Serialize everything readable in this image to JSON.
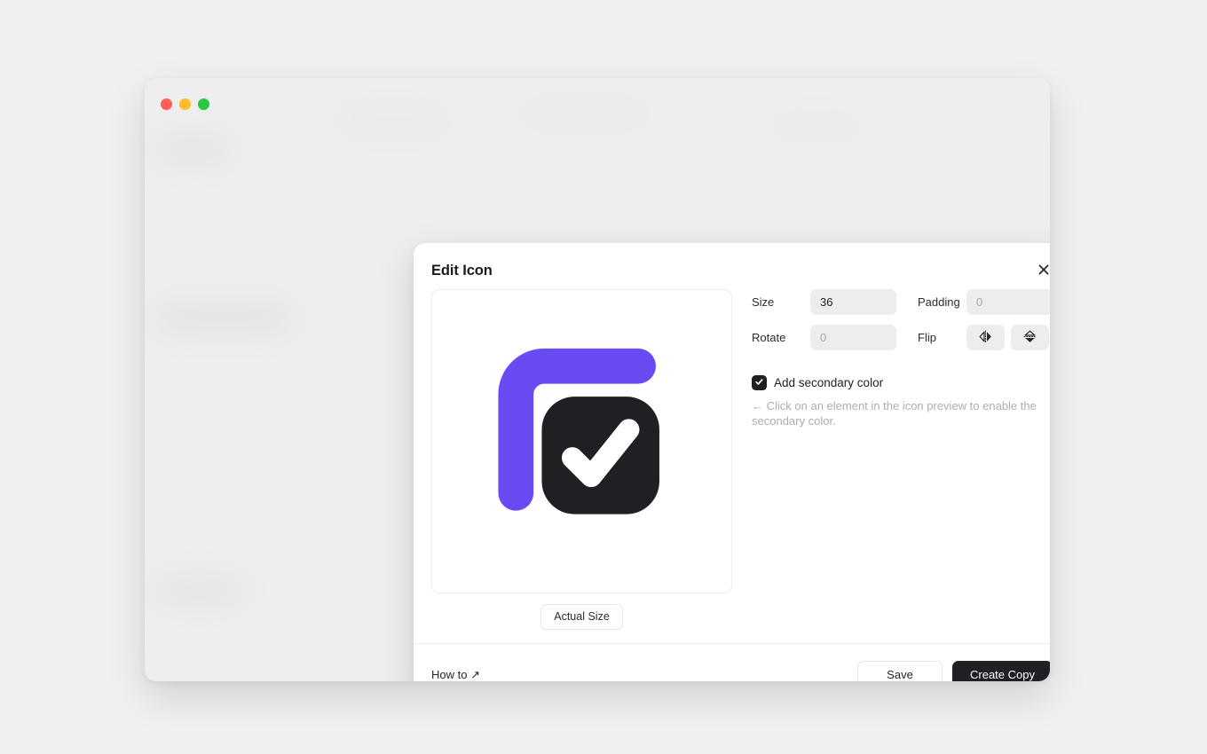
{
  "window": {
    "traffic_lights": [
      {
        "name": "close",
        "color": "#ff5f57"
      },
      {
        "name": "minimize",
        "color": "#febc2e"
      },
      {
        "name": "maximize",
        "color": "#28c840"
      }
    ]
  },
  "modal": {
    "title": "Edit Icon",
    "close_icon": "close-icon",
    "preview": {
      "actual_size_label": "Actual Size",
      "icon_name": "copy-check-icon",
      "primary_color": "#1e2023",
      "secondary_color": "#6a4af2"
    },
    "controls": {
      "size": {
        "label": "Size",
        "value": "36",
        "placeholder": "0"
      },
      "rotate": {
        "label": "Rotate",
        "value": "",
        "placeholder": "0"
      },
      "padding": {
        "label": "Padding",
        "value": "",
        "placeholder": "0"
      },
      "flip": {
        "label": "Flip",
        "buttons": [
          {
            "name": "flip-horizontal-icon",
            "title": "Flip horizontal"
          },
          {
            "name": "flip-vertical-icon",
            "title": "Flip vertical"
          }
        ]
      }
    },
    "secondary_color": {
      "checked": true,
      "label": "Add secondary color",
      "hint": "← Click on an element in the icon preview to enable the secondary color."
    },
    "footer": {
      "how_to_label": "How to ↗",
      "save_label": "Save",
      "create_copy_label": "Create Copy"
    }
  }
}
